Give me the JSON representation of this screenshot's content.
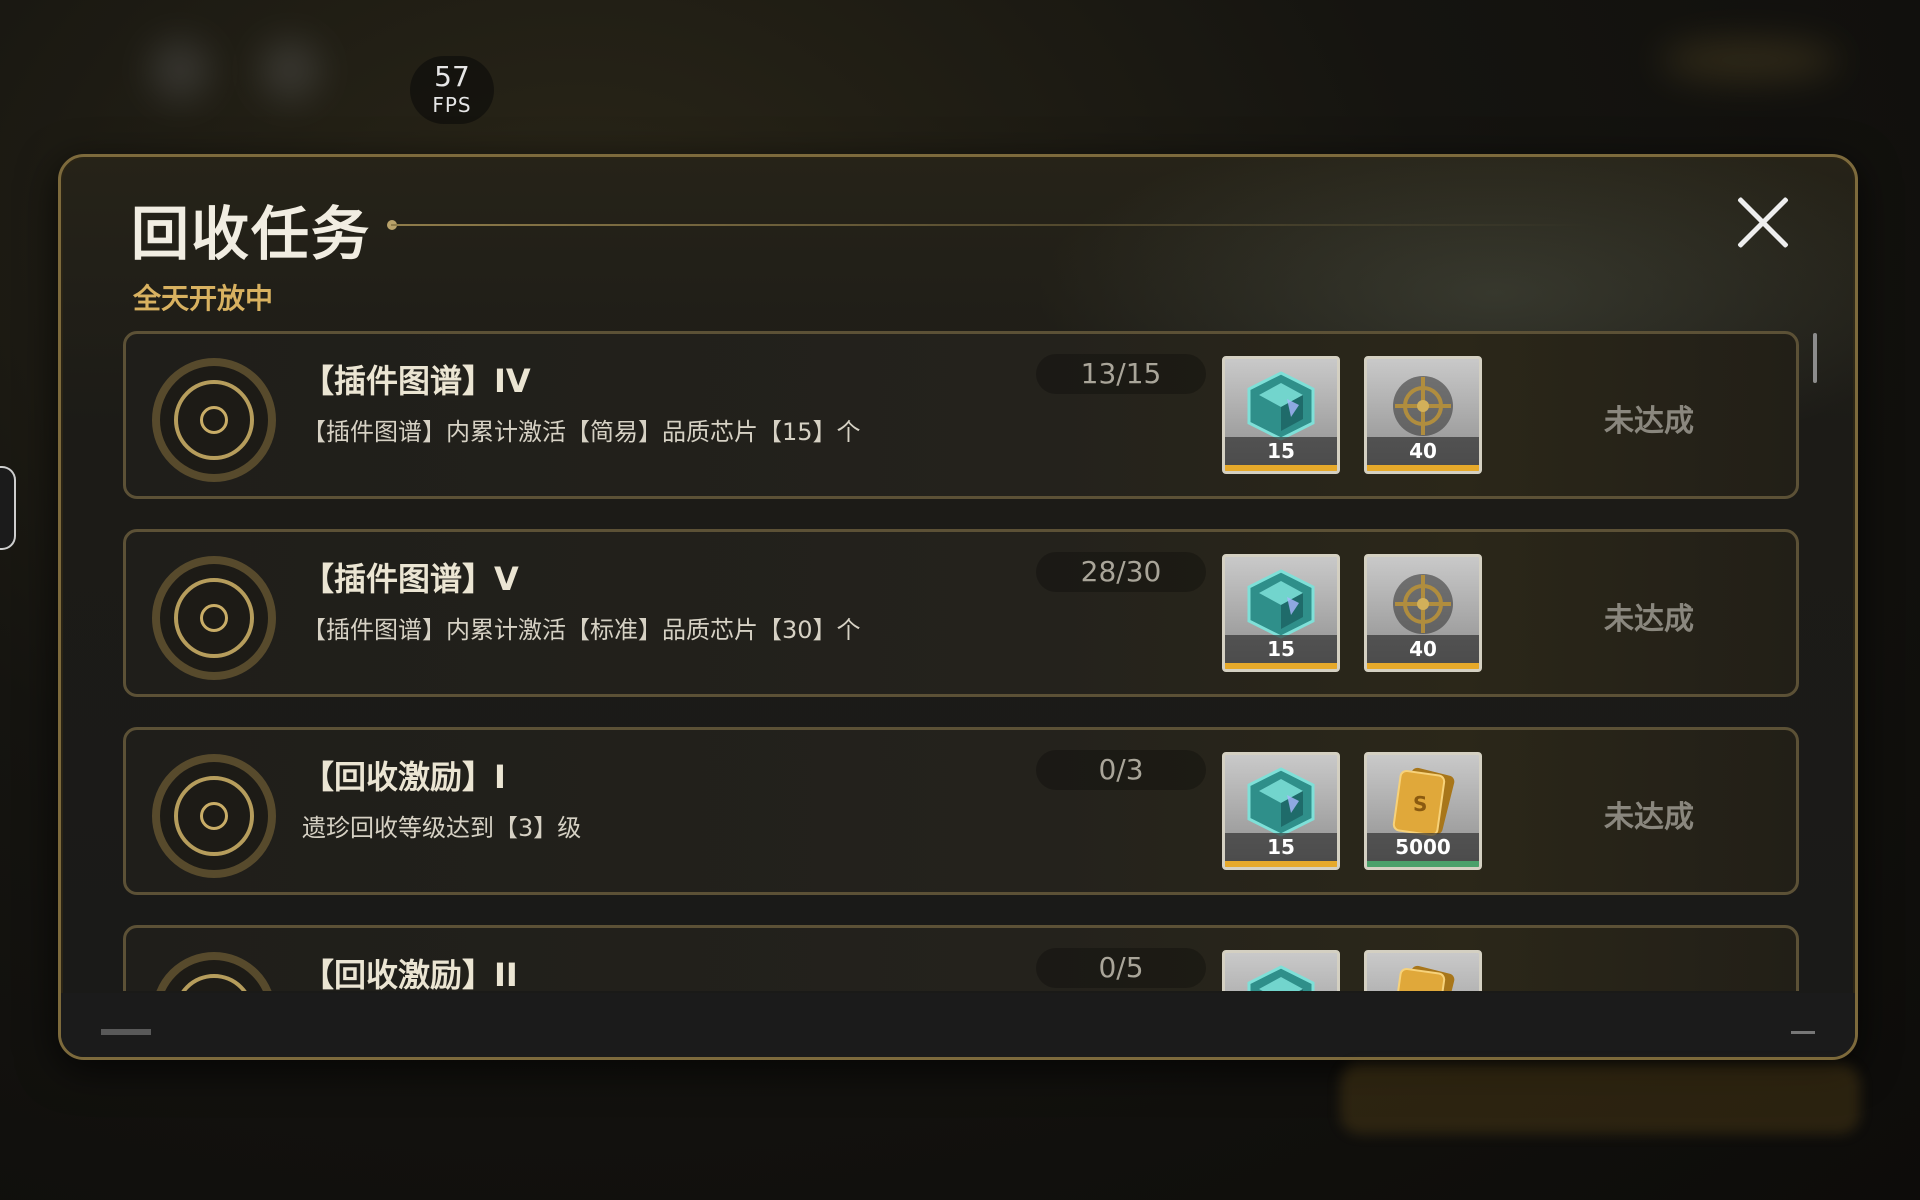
{
  "fps": {
    "value": "57",
    "label": "FPS"
  },
  "panel": {
    "title": "回收任务",
    "subtitle": "全天开放中"
  },
  "colors": {
    "accent": "#d8b160",
    "rarity_gold": "#e6a92a",
    "rarity_green": "#4aa06a"
  },
  "tasks": [
    {
      "title": "【插件图谱】IV",
      "description": "【插件图谱】内累计激活【简易】品质芯片【15】个",
      "progress": "13/15",
      "status": "未达成",
      "rewards": [
        {
          "icon": "crystal-icon",
          "quantity": "15",
          "rarity_color": "#e6a92a"
        },
        {
          "icon": "emblem-icon",
          "quantity": "40",
          "rarity_color": "#e6a92a"
        }
      ]
    },
    {
      "title": "【插件图谱】V",
      "description": "【插件图谱】内累计激活【标准】品质芯片【30】个",
      "progress": "28/30",
      "status": "未达成",
      "rewards": [
        {
          "icon": "crystal-icon",
          "quantity": "15",
          "rarity_color": "#e6a92a"
        },
        {
          "icon": "emblem-icon",
          "quantity": "40",
          "rarity_color": "#e6a92a"
        }
      ]
    },
    {
      "title": "【回收激励】I",
      "description": "遗珍回收等级达到【3】级",
      "progress": "0/3",
      "status": "未达成",
      "rewards": [
        {
          "icon": "crystal-icon",
          "quantity": "15",
          "rarity_color": "#e6a92a"
        },
        {
          "icon": "gold-bar-icon",
          "quantity": "5000",
          "rarity_color": "#4aa06a"
        }
      ]
    },
    {
      "title": "【回收激励】II",
      "description": "",
      "progress": "0/5",
      "status": "",
      "rewards": [
        {
          "icon": "crystal-icon",
          "quantity": "",
          "rarity_color": "#e6a92a"
        },
        {
          "icon": "gold-bar-icon",
          "quantity": "",
          "rarity_color": "#4aa06a"
        }
      ]
    }
  ]
}
